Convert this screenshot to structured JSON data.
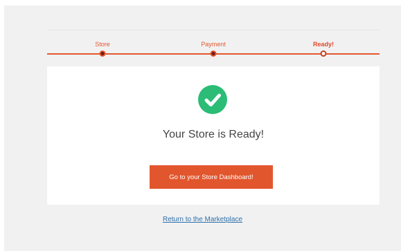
{
  "steps": [
    {
      "label": "Store",
      "state": "complete"
    },
    {
      "label": "Payment",
      "state": "complete"
    },
    {
      "label": "Ready!",
      "state": "current"
    }
  ],
  "confirmation": {
    "icon": "checkmark-circle-icon",
    "title": "Your Store is Ready!",
    "button_label": "Go to your Store Dashboard!"
  },
  "footer": {
    "link_label": "Return to the Marketplace"
  },
  "colors": {
    "accent": "#e2562d",
    "success": "#2bbc76",
    "link": "#2d6fa8",
    "background": "#f1f1f2"
  }
}
